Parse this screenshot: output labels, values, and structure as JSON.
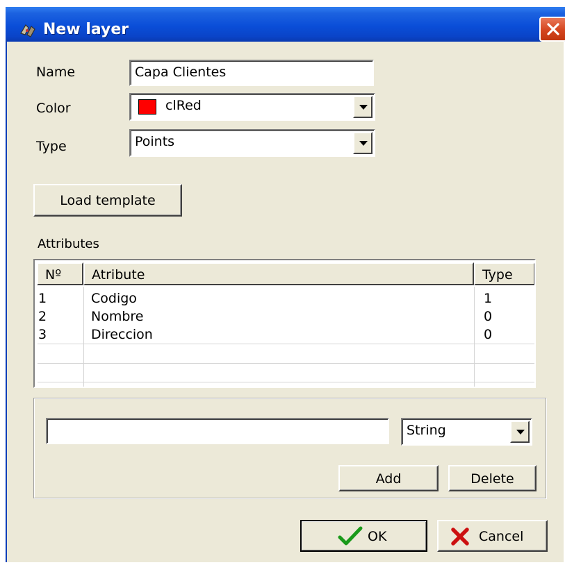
{
  "window": {
    "title": "New layer"
  },
  "form": {
    "name_label": "Name",
    "name_value": "Capa Clientes",
    "color_label": "Color",
    "color_value": "clRed",
    "color_swatch": "#ff0000",
    "type_label": "Type",
    "type_value": "Points",
    "load_template_label": "Load template"
  },
  "attributes": {
    "section_label": "Attributes",
    "columns": [
      "Nº",
      "Atribute",
      "Type"
    ],
    "rows": [
      [
        "1",
        "Codigo",
        "1"
      ],
      [
        "2",
        "Nombre",
        "0"
      ],
      [
        "3",
        "Direccion",
        "0"
      ]
    ]
  },
  "editor": {
    "attribute_input_value": "",
    "attribute_type_value": "String",
    "add_label": "Add",
    "delete_label": "Delete"
  },
  "footer": {
    "ok_label": "OK",
    "cancel_label": "Cancel"
  },
  "colors": {
    "title_bar": "#0a4ed8",
    "dialog_bg": "#ece9d8",
    "ok_check": "#1a9a1a",
    "cancel_x": "#cc1111"
  }
}
